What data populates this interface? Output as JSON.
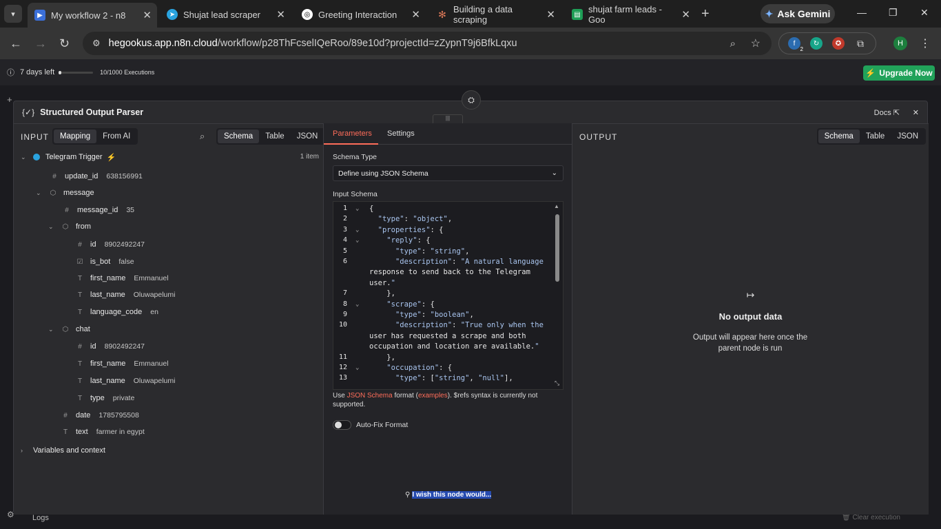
{
  "browser": {
    "tabs": [
      {
        "title": "My workflow 2 - n8",
        "icon": "n8n-icon",
        "active": true
      },
      {
        "title": "Shujat lead scraper",
        "icon": "telegram-icon",
        "active": false
      },
      {
        "title": "Greeting Interaction",
        "icon": "chatgpt-icon",
        "active": false
      },
      {
        "title": "Building a data scraping",
        "icon": "claude-icon",
        "active": false
      },
      {
        "title": "shujat farm leads - Goo",
        "icon": "sheets-icon",
        "active": false
      }
    ],
    "gemini_label": "Ask Gemini",
    "url_host": "hegookus.app.n8n.cloud",
    "url_path": "/workflow/p28ThFcselIQeRoo/89e10d?projectId=zZypnT9j6BfkLqxu",
    "ext_badge": "2",
    "profile_initial": "H"
  },
  "banner": {
    "trial": "7 days left",
    "executions": "10/1000 Executions",
    "upgrade": "Upgrade Now"
  },
  "node": {
    "title": "Structured Output Parser",
    "docs": "Docs"
  },
  "input": {
    "title": "INPUT",
    "modes": [
      "Mapping",
      "From AI"
    ],
    "views": [
      "Schema",
      "Table",
      "JSON"
    ],
    "trigger": "Telegram Trigger",
    "item_count": "1 item",
    "fields": [
      {
        "k": "update_id",
        "v": "638156991"
      },
      {
        "k": "message",
        "v": ""
      },
      {
        "k": "message_id",
        "v": "35"
      },
      {
        "k": "from",
        "v": ""
      },
      {
        "k": "id",
        "v": "8902492247"
      },
      {
        "k": "is_bot",
        "v": "false"
      },
      {
        "k": "first_name",
        "v": "Emmanuel"
      },
      {
        "k": "last_name",
        "v": "Oluwapelumi"
      },
      {
        "k": "language_code",
        "v": "en"
      },
      {
        "k": "chat",
        "v": ""
      },
      {
        "k": "id",
        "v": "8902492247"
      },
      {
        "k": "first_name",
        "v": "Emmanuel"
      },
      {
        "k": "last_name",
        "v": "Oluwapelumi"
      },
      {
        "k": "type",
        "v": "private"
      },
      {
        "k": "date",
        "v": "1785795508"
      },
      {
        "k": "text",
        "v": "farmer in egypt"
      }
    ],
    "variables": "Variables and context"
  },
  "params": {
    "tabs": [
      "Parameters",
      "Settings"
    ],
    "schema_type_label": "Schema Type",
    "schema_type_value": "Define using JSON Schema",
    "input_schema_label": "Input Schema",
    "code": [
      {
        "n": "1",
        "t": "{"
      },
      {
        "n": "2",
        "t": "  \"type\": \"object\","
      },
      {
        "n": "3",
        "t": "  \"properties\": {"
      },
      {
        "n": "4",
        "t": "    \"reply\": {"
      },
      {
        "n": "5",
        "t": "      \"type\": \"string\","
      },
      {
        "n": "6",
        "t": "      \"description\": \"A natural language"
      },
      {
        "n": "",
        "t": "response to send back to the Telegram"
      },
      {
        "n": "",
        "t": "user.\""
      },
      {
        "n": "7",
        "t": "    },"
      },
      {
        "n": "8",
        "t": "    \"scrape\": {"
      },
      {
        "n": "9",
        "t": "      \"type\": \"boolean\","
      },
      {
        "n": "10",
        "t": "      \"description\": \"True only when the"
      },
      {
        "n": "",
        "t": "user has requested a scrape and both"
      },
      {
        "n": "",
        "t": "occupation and location are available.\""
      },
      {
        "n": "11",
        "t": "    },"
      },
      {
        "n": "12",
        "t": "    \"occupation\": {"
      },
      {
        "n": "13",
        "t": "      \"type\": [\"string\", \"null\"],"
      }
    ],
    "hint_prefix": "Use ",
    "hint_link1": "JSON Schema",
    "hint_mid": " format (",
    "hint_link2": "examples",
    "hint_suffix": "). $refs syntax is currently not supported.",
    "autofix_label": "Auto-Fix Format",
    "feedback": "I wish this node would..."
  },
  "output": {
    "title": "OUTPUT",
    "views": [
      "Schema",
      "Table",
      "JSON"
    ],
    "empty_title": "No output data",
    "empty_text": "Output will appear here once the parent node is run"
  },
  "footer": {
    "logs": "Logs",
    "clear": "Clear execution"
  },
  "colors": {
    "accent": "#ff6d5a",
    "upgrade": "#21a25a",
    "panel": "#2b2b2e"
  }
}
